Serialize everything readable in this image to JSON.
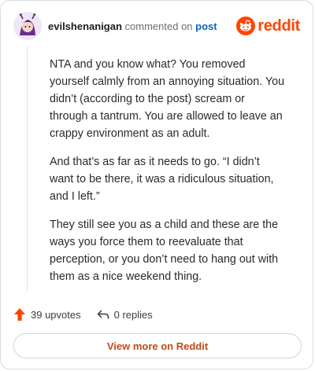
{
  "header": {
    "username": "evilshenanigan",
    "action_text": "commented on",
    "post_link": "post",
    "brand": "reddit"
  },
  "comment": {
    "paragraphs": [
      "NTA and you know what? You removed yourself calmly from an annoying situation. You didn’t (according to the post) scream or through a tantrum. You are allowed to leave an crappy environment as an adult.",
      "And that’s as far as it needs to go. “I didn’t want to be there, it was a ridiculous situation, and I left.”",
      "They still see you as a child and these are the ways you force them to reevaluate that perception, or you don’t need to hang out with them as a nice weekend thing."
    ]
  },
  "actions": {
    "upvotes": "39 upvotes",
    "replies": "0 replies"
  },
  "footer": {
    "view_more": "View more on Reddit"
  },
  "colors": {
    "brand": "#ff4500",
    "link": "#0b66c2",
    "upvote": "#ff4500"
  },
  "icons": [
    "avatar",
    "reddit-logo-icon",
    "upvote-arrow-icon",
    "reply-icon"
  ]
}
